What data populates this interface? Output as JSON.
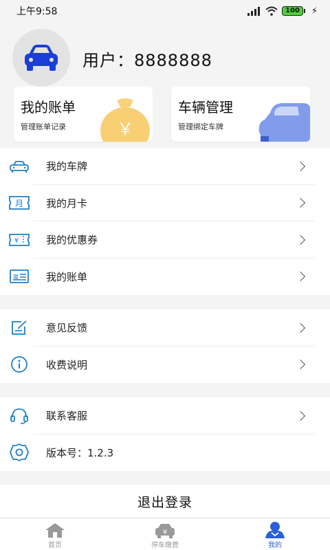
{
  "status_bar": {
    "time": "上午9:58",
    "battery": "100"
  },
  "user": {
    "label": "用户：8888888"
  },
  "cards": [
    {
      "title": "我的账单",
      "subtitle": "管理账单记录",
      "coin_symbol": "￥"
    },
    {
      "title": "车辆管理",
      "subtitle": "管理绑定车牌"
    }
  ],
  "menu_group_1": [
    {
      "label": "我的车牌",
      "icon": "car-plate-icon"
    },
    {
      "label": "我的月卡",
      "icon": "month-card-icon",
      "icon_text": "月"
    },
    {
      "label": "我的优惠券",
      "icon": "coupon-icon",
      "icon_text": "¥"
    },
    {
      "label": "我的账单",
      "icon": "bill-icon",
      "icon_text": "票"
    }
  ],
  "menu_group_2": [
    {
      "label": "意见反馈",
      "icon": "feedback-icon"
    },
    {
      "label": "收费说明",
      "icon": "info-icon"
    }
  ],
  "menu_group_3": [
    {
      "label": "联系客服",
      "icon": "headset-icon"
    },
    {
      "label": "版本号：1.2.3",
      "icon": "settings-icon"
    }
  ],
  "logout_label": "退出登录",
  "tabs": [
    {
      "label": "首页",
      "icon": "home-icon",
      "active": false
    },
    {
      "label": "停车缴费",
      "icon": "parking-pay-icon",
      "active": false
    },
    {
      "label": "我的",
      "icon": "user-icon",
      "active": true
    }
  ],
  "colors": {
    "accent": "#2a5fd8",
    "icon_blue": "#1e7fc8",
    "coin": "#f7c85a"
  }
}
